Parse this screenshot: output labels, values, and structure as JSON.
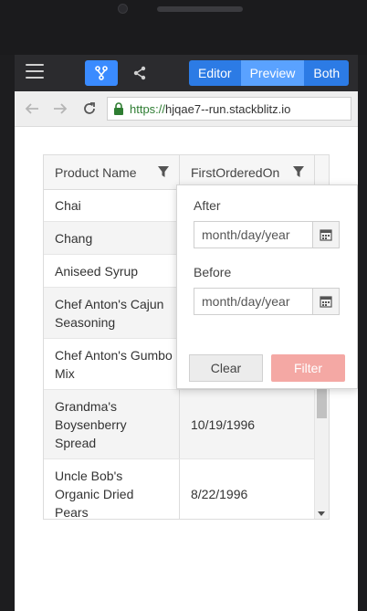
{
  "toolbar": {
    "views": [
      {
        "label": "Editor"
      },
      {
        "label": "Preview"
      },
      {
        "label": "Both"
      }
    ]
  },
  "browser": {
    "url_scheme": "https://",
    "url_host": "hjqae7--run.stackblitz.io"
  },
  "grid": {
    "columns": [
      {
        "label": "Product Name"
      },
      {
        "label": "FirstOrderedOn"
      }
    ],
    "rows": [
      {
        "product": "Chai",
        "date": ""
      },
      {
        "product": "Chang",
        "date": ""
      },
      {
        "product": "Aniseed Syrup",
        "date": ""
      },
      {
        "product": "Chef Anton's Cajun Seasoning",
        "date": ""
      },
      {
        "product": "Chef Anton's Gumbo Mix",
        "date": ""
      },
      {
        "product": "Grandma's Boysenberry Spread",
        "date": "10/19/1996"
      },
      {
        "product": "Uncle Bob's Organic Dried Pears",
        "date": "8/22/1996"
      }
    ]
  },
  "filter_popup": {
    "after_label": "After",
    "after_placeholder": "month/day/year",
    "before_label": "Before",
    "before_placeholder": "month/day/year",
    "clear_label": "Clear",
    "filter_label": "Filter"
  },
  "colors": {
    "accent": "#2c7be5",
    "active_view": "#5aa2ff",
    "filter_button": "#f4a8a4"
  }
}
